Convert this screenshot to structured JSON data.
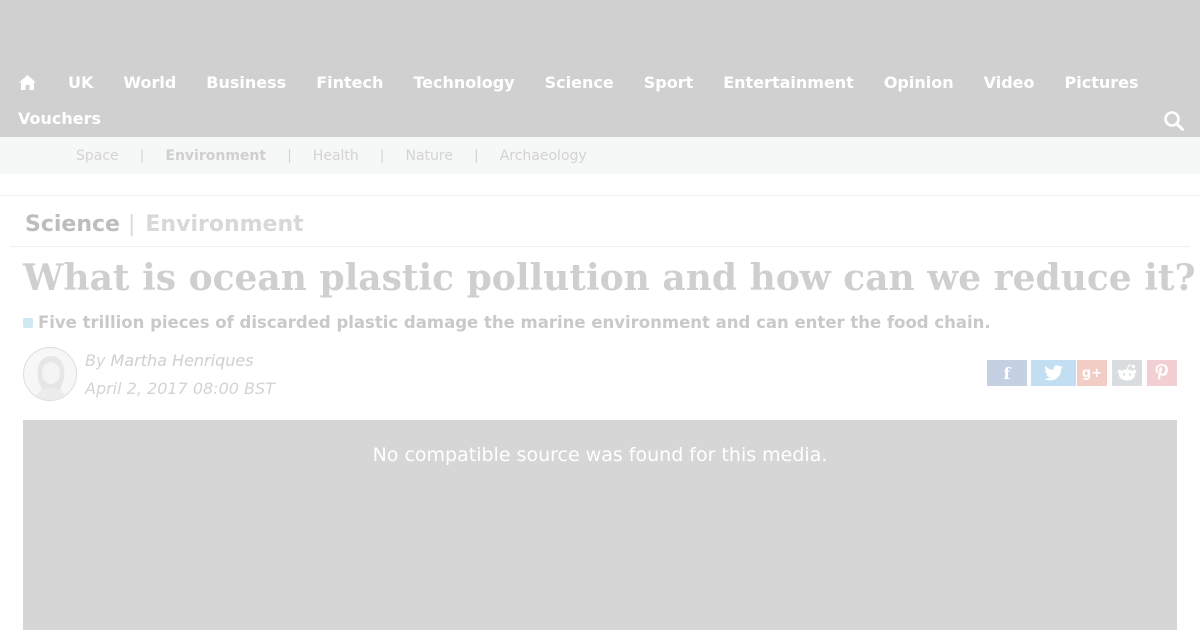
{
  "nav": {
    "home_icon": "home-icon",
    "items": [
      "UK",
      "World",
      "Business",
      "Fintech",
      "Technology",
      "Science",
      "Sport",
      "Entertainment",
      "Opinion",
      "Video",
      "Pictures"
    ],
    "second_row": [
      "Vouchers"
    ],
    "search_icon": "search-icon"
  },
  "subnav": {
    "items": [
      "Space",
      "Environment",
      "Health",
      "Nature",
      "Archaeology"
    ],
    "active": "Environment"
  },
  "breadcrumb": {
    "section": "Science",
    "separator": "|",
    "subsection": "Environment"
  },
  "article": {
    "headline": "What is ocean plastic pollution and how can we reduce it?",
    "summary": "Five trillion pieces of discarded plastic damage the marine environment and can enter the food chain.",
    "author_prefix": "By",
    "author": "Martha Henriques",
    "date": "April 2, 2017 08:00 BST"
  },
  "share": {
    "facebook": "f",
    "google_plus": "g+",
    "icons": [
      "facebook-icon",
      "twitter-icon",
      "google-plus-icon",
      "reddit-icon",
      "pinterest-icon"
    ]
  },
  "video": {
    "message": "No compatible source was found for this media."
  },
  "colors": {
    "topbar": "#d0d0d0",
    "subnav": "#f6f7f7",
    "video": "#d6d6d6"
  }
}
